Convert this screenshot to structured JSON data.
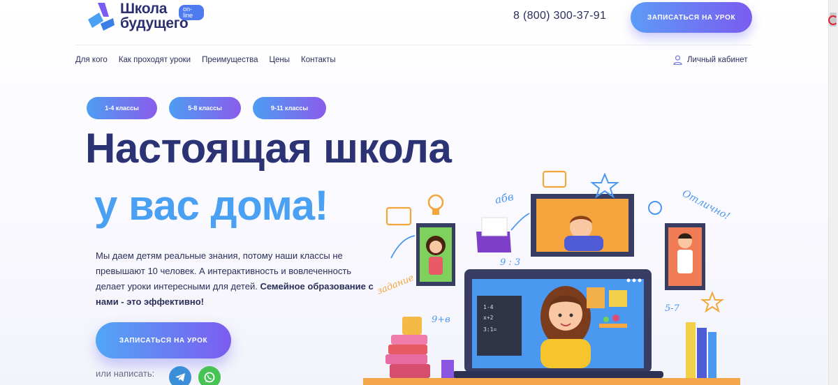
{
  "logo": {
    "line1": "Школа",
    "line2": "будущего",
    "badge": "on-line"
  },
  "header": {
    "phone": "8 (800) 300-37-91",
    "cta": "ЗАПИСАТЬСЯ НА УРОК"
  },
  "nav": {
    "items": [
      "Для кого",
      "Как проходят уроки",
      "Преимущества",
      "Цены",
      "Контакты"
    ],
    "cabinet": "Личный кабинет"
  },
  "grades": [
    "1-4 классы",
    "5-8 классы",
    "9-11 классы"
  ],
  "hero": {
    "title": "Настоящая школа",
    "subtitle": "у вас дома!",
    "desc_1": "Мы даем детям реальные знания, потому наши классы не превышают 10 человек. А интерактивность и вовлеченность делает уроки интересными для детей.",
    "desc_2": "Семейное образование с нами - это эффективно!",
    "cta": "ЗАПИСАТЬСЯ НА УРОК",
    "write": "или написать:"
  },
  "illustration": {
    "notes": [
      "абв",
      "Отлично!",
      "задание",
      "9 : 3",
      "9+в",
      "5-7"
    ]
  },
  "colors": {
    "navy": "#2c3374",
    "blue": "#4aa0f3",
    "violet": "#7a5cf0",
    "telegram": "#3a8fd8",
    "whatsapp": "#47c255"
  },
  "icons": {
    "cabinet": "user-icon",
    "telegram": "telegram-icon",
    "whatsapp": "whatsapp-icon"
  }
}
